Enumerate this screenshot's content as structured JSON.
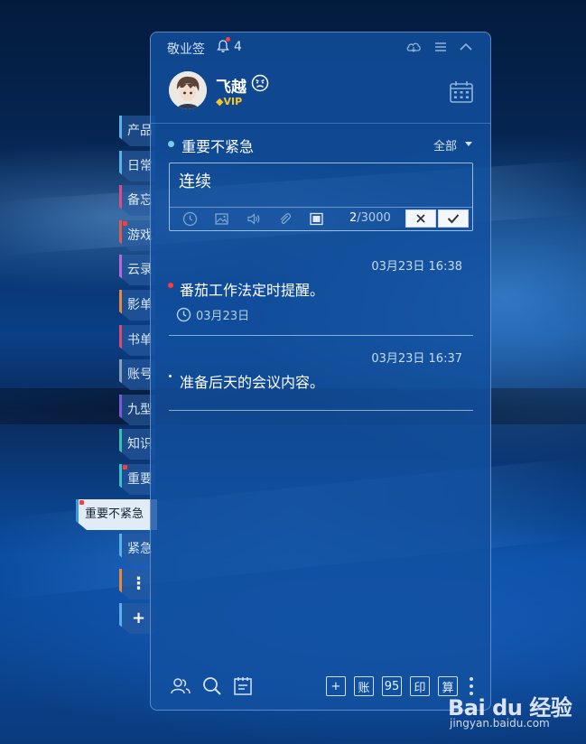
{
  "app": {
    "name": "敬业签",
    "notification_count": "4"
  },
  "user": {
    "name": "飞越",
    "vip_label": "VIP"
  },
  "category": {
    "name": "重要不紧急",
    "filter_label": "全部"
  },
  "editor": {
    "text": "连续",
    "char_count": "2",
    "char_limit": "/3000"
  },
  "notes": [
    {
      "time": "03月23日 16:38",
      "text": "番茄工作法定时提醒。",
      "reminder": "03月23日",
      "bullet_color": "#ff3b3b"
    },
    {
      "time": "03月23日 16:37",
      "text": "准备后天的会议内容。",
      "bullet_color": "#ffffff"
    }
  ],
  "side_tabs": [
    {
      "label": "产品",
      "dot": false,
      "color": "#5bb0e8"
    },
    {
      "label": "日常",
      "dot": false,
      "color": "#5bb0e8"
    },
    {
      "label": "备忘",
      "dot": false,
      "color": "#e04a8a"
    },
    {
      "label": "游戏",
      "dot": true,
      "color": "#e05a4a"
    },
    {
      "label": "云录",
      "dot": false,
      "color": "#b76ad6"
    },
    {
      "label": "影单",
      "dot": false,
      "color": "#e58a3a"
    },
    {
      "label": "书单",
      "dot": false,
      "color": "#e04a6a"
    },
    {
      "label": "账号",
      "dot": false,
      "color": "#8aa0b8"
    },
    {
      "label": "九型",
      "dot": false,
      "color": "#7a5ad6"
    },
    {
      "label": "知识",
      "dot": false,
      "color": "#3ac0b0"
    },
    {
      "label": "重要",
      "dot": true,
      "color": "#3ac0c8"
    },
    {
      "label": "重要不紧急",
      "dot": true,
      "color": "#3a9ae0",
      "active": true
    },
    {
      "label": "紧急",
      "dot": false,
      "color": "#5bb0e8"
    }
  ],
  "side_controls": {
    "more": "⋮",
    "add": "+"
  },
  "bottom_buttons": [
    "+",
    "账",
    "95",
    "印",
    "算"
  ],
  "watermark": {
    "logo": "Bai du 经验",
    "url": "jingyan.baidu.com"
  },
  "colors": {
    "accent": "#3a9ae0",
    "panel": "#1250a0",
    "alert": "#ff3b3b"
  }
}
